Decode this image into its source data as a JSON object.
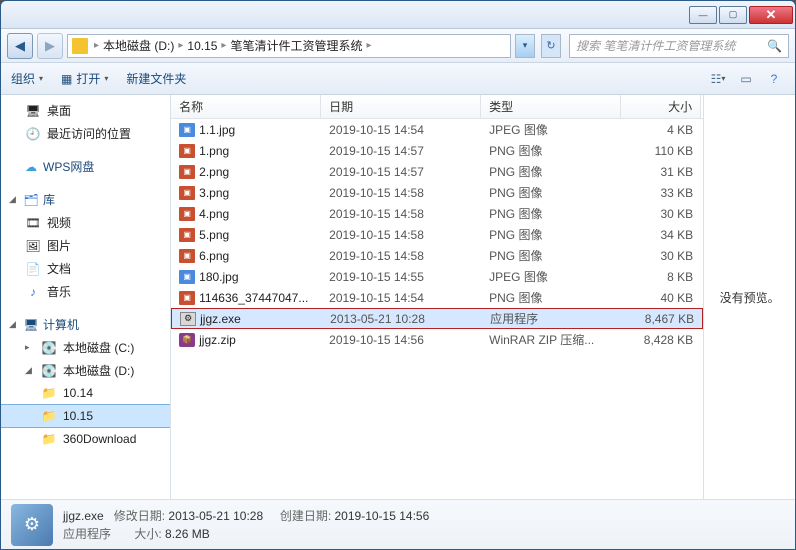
{
  "titlebar": {
    "min": "—",
    "max": "▢",
    "close": "✕"
  },
  "nav": {
    "back": "◀",
    "fwd": "▶",
    "breadcrumb": [
      "本地磁盘 (D:)",
      "10.15",
      "笔笔清计件工资管理系统"
    ],
    "sep": "▸",
    "refresh": "↻",
    "search_placeholder": "搜索 笔笔清计件工资管理系统",
    "search_icon": "🔍"
  },
  "toolbar": {
    "organize": "组织",
    "open": "打开",
    "newfolder": "新建文件夹",
    "dd": "▾",
    "open_icon": "▦"
  },
  "sidebar": {
    "desktop": "桌面",
    "recent": "最近访问的位置",
    "wps": "WPS网盘",
    "lib": "库",
    "video": "视频",
    "pictures": "图片",
    "docs": "文档",
    "music": "音乐",
    "computer": "计算机",
    "c": "本地磁盘 (C:)",
    "d": "本地磁盘 (D:)",
    "f1": "10.14",
    "f2": "10.15",
    "f3": "360Download"
  },
  "columns": {
    "name": "名称",
    "date": "日期",
    "type": "类型",
    "size": "大小"
  },
  "files": [
    {
      "icon": "jpg",
      "name": "1.1.jpg",
      "date": "2019-10-15 14:54",
      "type": "JPEG 图像",
      "size": "4 KB"
    },
    {
      "icon": "img",
      "name": "1.png",
      "date": "2019-10-15 14:57",
      "type": "PNG 图像",
      "size": "110 KB"
    },
    {
      "icon": "img",
      "name": "2.png",
      "date": "2019-10-15 14:57",
      "type": "PNG 图像",
      "size": "31 KB"
    },
    {
      "icon": "img",
      "name": "3.png",
      "date": "2019-10-15 14:58",
      "type": "PNG 图像",
      "size": "33 KB"
    },
    {
      "icon": "img",
      "name": "4.png",
      "date": "2019-10-15 14:58",
      "type": "PNG 图像",
      "size": "30 KB"
    },
    {
      "icon": "img",
      "name": "5.png",
      "date": "2019-10-15 14:58",
      "type": "PNG 图像",
      "size": "34 KB"
    },
    {
      "icon": "img",
      "name": "6.png",
      "date": "2019-10-15 14:58",
      "type": "PNG 图像",
      "size": "30 KB"
    },
    {
      "icon": "jpg",
      "name": "180.jpg",
      "date": "2019-10-15 14:55",
      "type": "JPEG 图像",
      "size": "8 KB"
    },
    {
      "icon": "img",
      "name": "114636_37447047...",
      "date": "2019-10-15 14:54",
      "type": "PNG 图像",
      "size": "40 KB"
    },
    {
      "icon": "exe",
      "name": "jjgz.exe",
      "date": "2013-05-21 10:28",
      "type": "应用程序",
      "size": "8,467 KB",
      "hl": true
    },
    {
      "icon": "zip",
      "name": "jjgz.zip",
      "date": "2019-10-15 14:56",
      "type": "WinRAR ZIP 压缩...",
      "size": "8,428 KB"
    }
  ],
  "preview": {
    "msg": "没有预览。"
  },
  "status": {
    "filename": "jjgz.exe",
    "modlabel": "修改日期:",
    "moddate": "2013-05-21 10:28",
    "crtlabel": "创建日期:",
    "crtdate": "2019-10-15 14:56",
    "filetype": "应用程序",
    "sizelabel": "大小:",
    "size": "8.26 MB"
  }
}
